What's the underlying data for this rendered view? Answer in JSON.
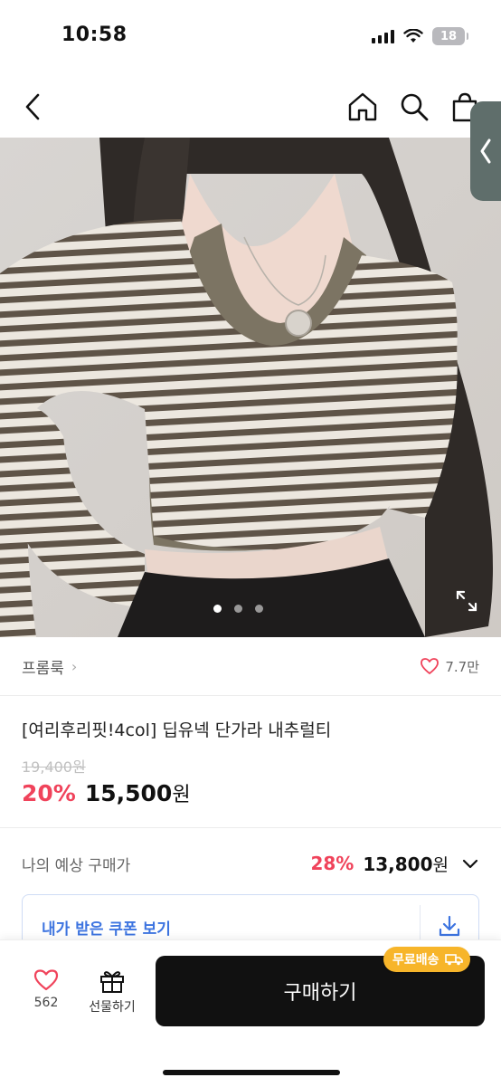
{
  "status_bar": {
    "time": "10:58",
    "battery": "18"
  },
  "nav": {
    "back_icon": "chevron-left-icon",
    "home_icon": "home-icon",
    "search_icon": "search-icon",
    "bag_icon": "bag-icon"
  },
  "gallery": {
    "image_count": 3,
    "active_index": 0,
    "image_description": "model wearing striped crop top layered over olive tank"
  },
  "shop": {
    "name": "프롬룩",
    "like_count": "7.7만"
  },
  "product": {
    "title": "[여리후리핏!4col] 딥유넥 단가라 내추럴티",
    "original_price": "19,400원",
    "discount": "20%",
    "price_number": "15,500",
    "price_unit": "원"
  },
  "expected": {
    "label": "나의 예상 구매가",
    "discount": "28%",
    "price_number": "13,800",
    "price_unit": "원"
  },
  "coupon": {
    "label": "내가 받은 쿠폰 보기"
  },
  "bottom": {
    "wish_count": "562",
    "gift_label": "선물하기",
    "buy_label": "구매하기",
    "shipping_badge": "무료배송"
  },
  "colors": {
    "accent_red": "#f0435b",
    "coupon_blue": "#3d74e0",
    "badge_orange": "#f7b52a",
    "button_black": "#111111"
  }
}
